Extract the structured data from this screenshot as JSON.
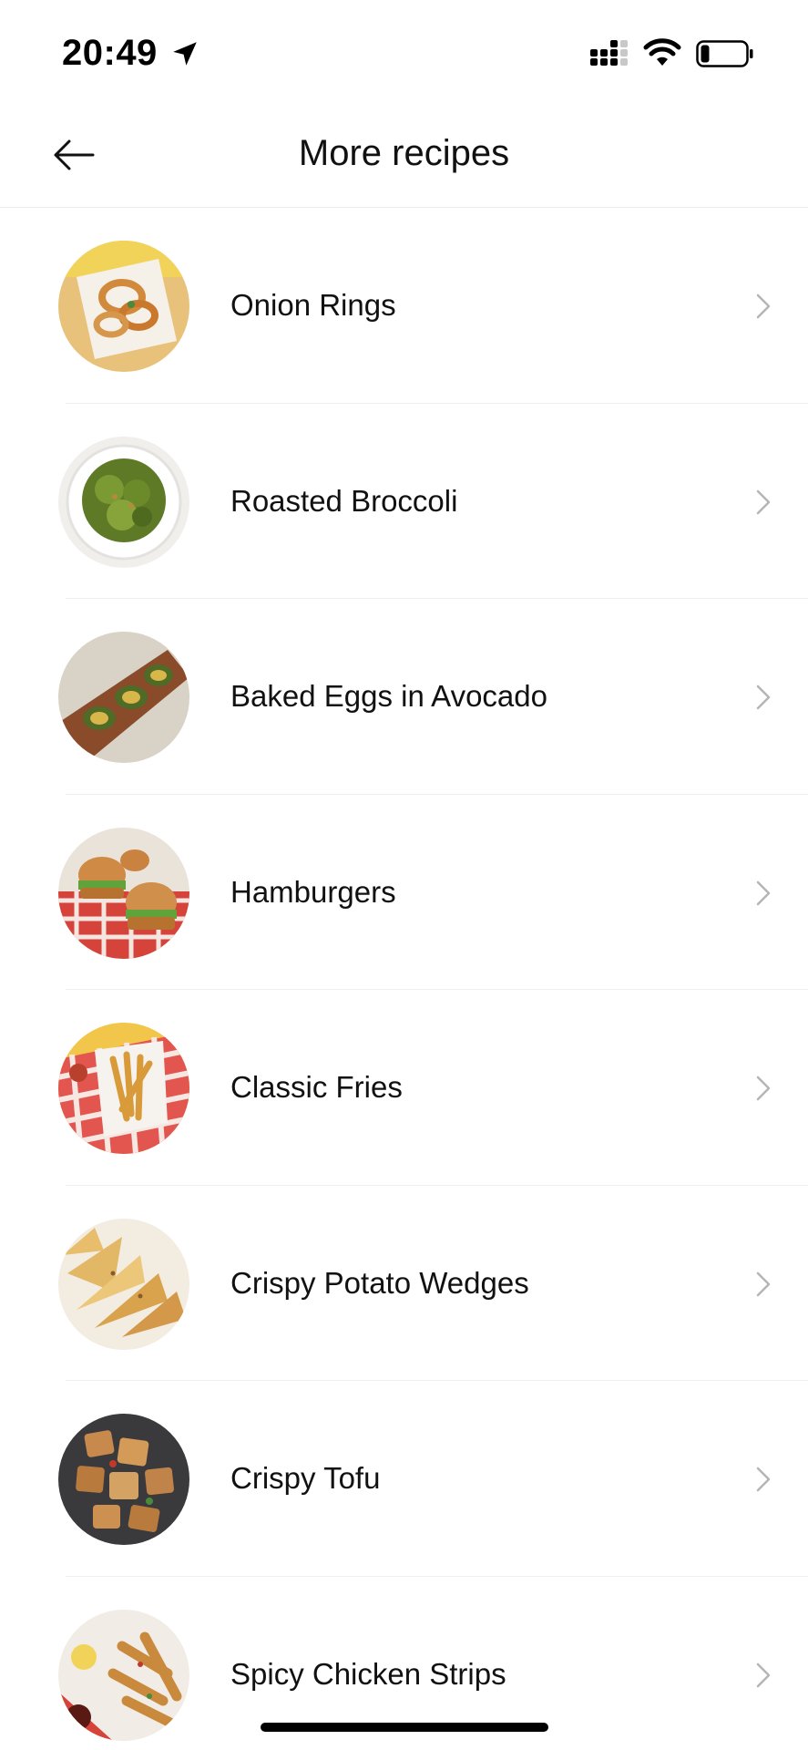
{
  "status_bar": {
    "time": "20:49",
    "icons": [
      "location-arrow-icon",
      "cellular-signal-icon",
      "wifi-icon",
      "battery-icon"
    ]
  },
  "nav": {
    "title": "More recipes",
    "back_icon": "arrow-left-icon"
  },
  "recipes": [
    {
      "name": "Onion Rings",
      "thumbnail": "onion-rings-photo"
    },
    {
      "name": "Roasted Broccoli",
      "thumbnail": "roasted-broccoli-photo"
    },
    {
      "name": "Baked Eggs in Avocado",
      "thumbnail": "baked-eggs-avocado-photo"
    },
    {
      "name": "Hamburgers",
      "thumbnail": "hamburgers-photo"
    },
    {
      "name": "Classic Fries",
      "thumbnail": "classic-fries-photo"
    },
    {
      "name": "Crispy Potato Wedges",
      "thumbnail": "potato-wedges-photo"
    },
    {
      "name": "Crispy Tofu",
      "thumbnail": "crispy-tofu-photo"
    },
    {
      "name": "Spicy Chicken Strips",
      "thumbnail": "chicken-strips-photo"
    }
  ],
  "colors": {
    "text": "#111111",
    "chevron": "#b5b5b5",
    "divider": "#efefef",
    "background": "#ffffff"
  }
}
